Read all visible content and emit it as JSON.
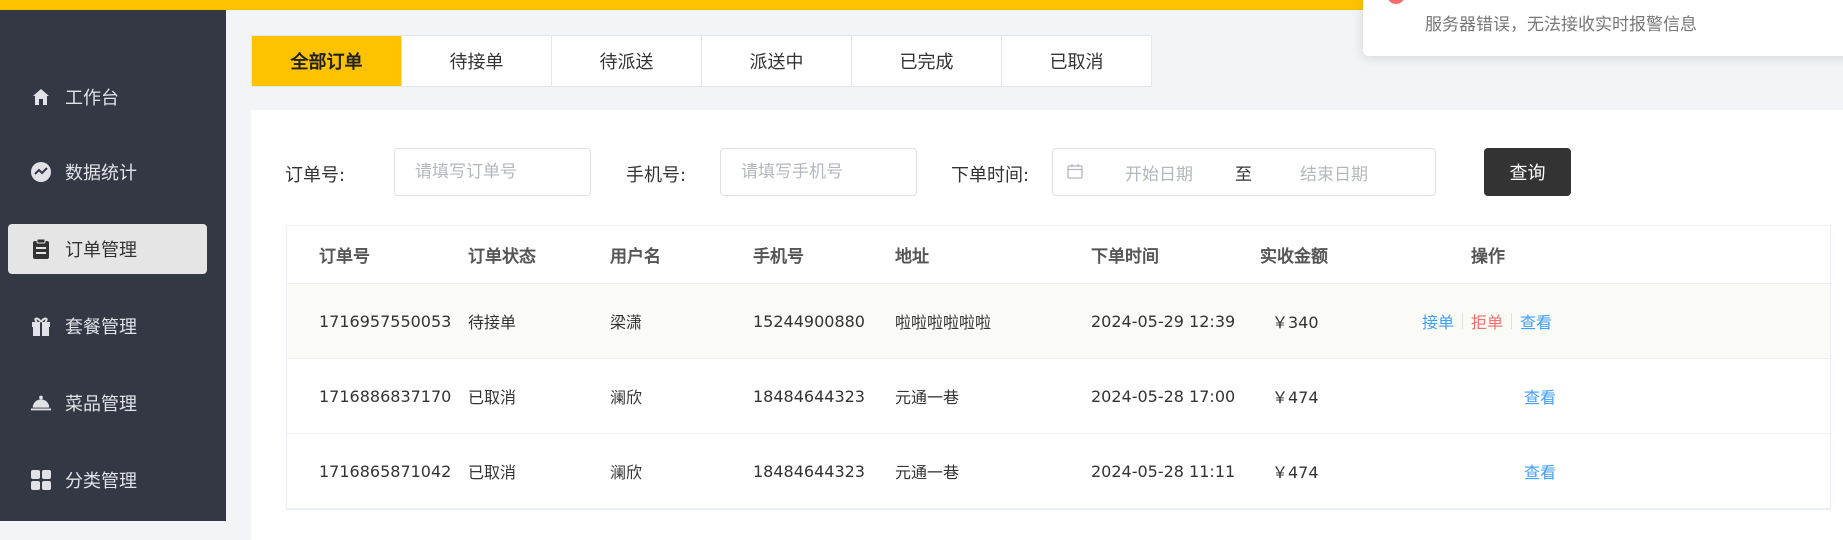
{
  "sidebar": {
    "items": [
      {
        "label": "工作台",
        "icon": "home-icon"
      },
      {
        "label": "数据统计",
        "icon": "chart-icon"
      },
      {
        "label": "订单管理",
        "icon": "clipboard-icon",
        "active": true
      },
      {
        "label": "套餐管理",
        "icon": "gift-icon"
      },
      {
        "label": "菜品管理",
        "icon": "dish-cover-icon"
      },
      {
        "label": "分类管理",
        "icon": "grid-icon"
      }
    ]
  },
  "tabs": [
    {
      "label": "全部订单",
      "active": true
    },
    {
      "label": "待接单"
    },
    {
      "label": "待派送"
    },
    {
      "label": "派送中"
    },
    {
      "label": "已完成"
    },
    {
      "label": "已取消"
    }
  ],
  "filters": {
    "order_no_label": "订单号:",
    "order_no_placeholder": "请填写订单号",
    "phone_label": "手机号:",
    "phone_placeholder": "请填写手机号",
    "time_label": "下单时间:",
    "start_placeholder": "开始日期",
    "range_sep": "至",
    "end_placeholder": "结束日期",
    "query_label": "查询"
  },
  "table": {
    "columns": [
      "订单号",
      "订单状态",
      "用户名",
      "手机号",
      "地址",
      "下单时间",
      "实收金额",
      "操作"
    ],
    "rows": [
      {
        "order_no": "1716957550053",
        "status": "待接单",
        "user": "梁潇",
        "phone": "15244900880",
        "address": "啦啦啦啦啦啦",
        "time": "2024-05-29 12:39",
        "amount": "￥340",
        "actions": [
          "接单",
          "拒单",
          "查看"
        ]
      },
      {
        "order_no": "1716886837170",
        "status": "已取消",
        "user": "澜欣",
        "phone": "18484644323",
        "address": "元通一巷",
        "time": "2024-05-28 17:00",
        "amount": "￥474",
        "actions": [
          "查看"
        ]
      },
      {
        "order_no": "1716865871042",
        "status": "已取消",
        "user": "澜欣",
        "phone": "18484644323",
        "address": "元通一巷",
        "time": "2024-05-28 11:11",
        "amount": "￥474",
        "actions": [
          "查看"
        ]
      }
    ]
  },
  "toast": {
    "message": "服务器错误，无法接收实时报警信息"
  },
  "colors": {
    "accent": "#ffc200",
    "sidebar": "#343744",
    "link": "#409eff",
    "danger": "#f56c6c"
  }
}
